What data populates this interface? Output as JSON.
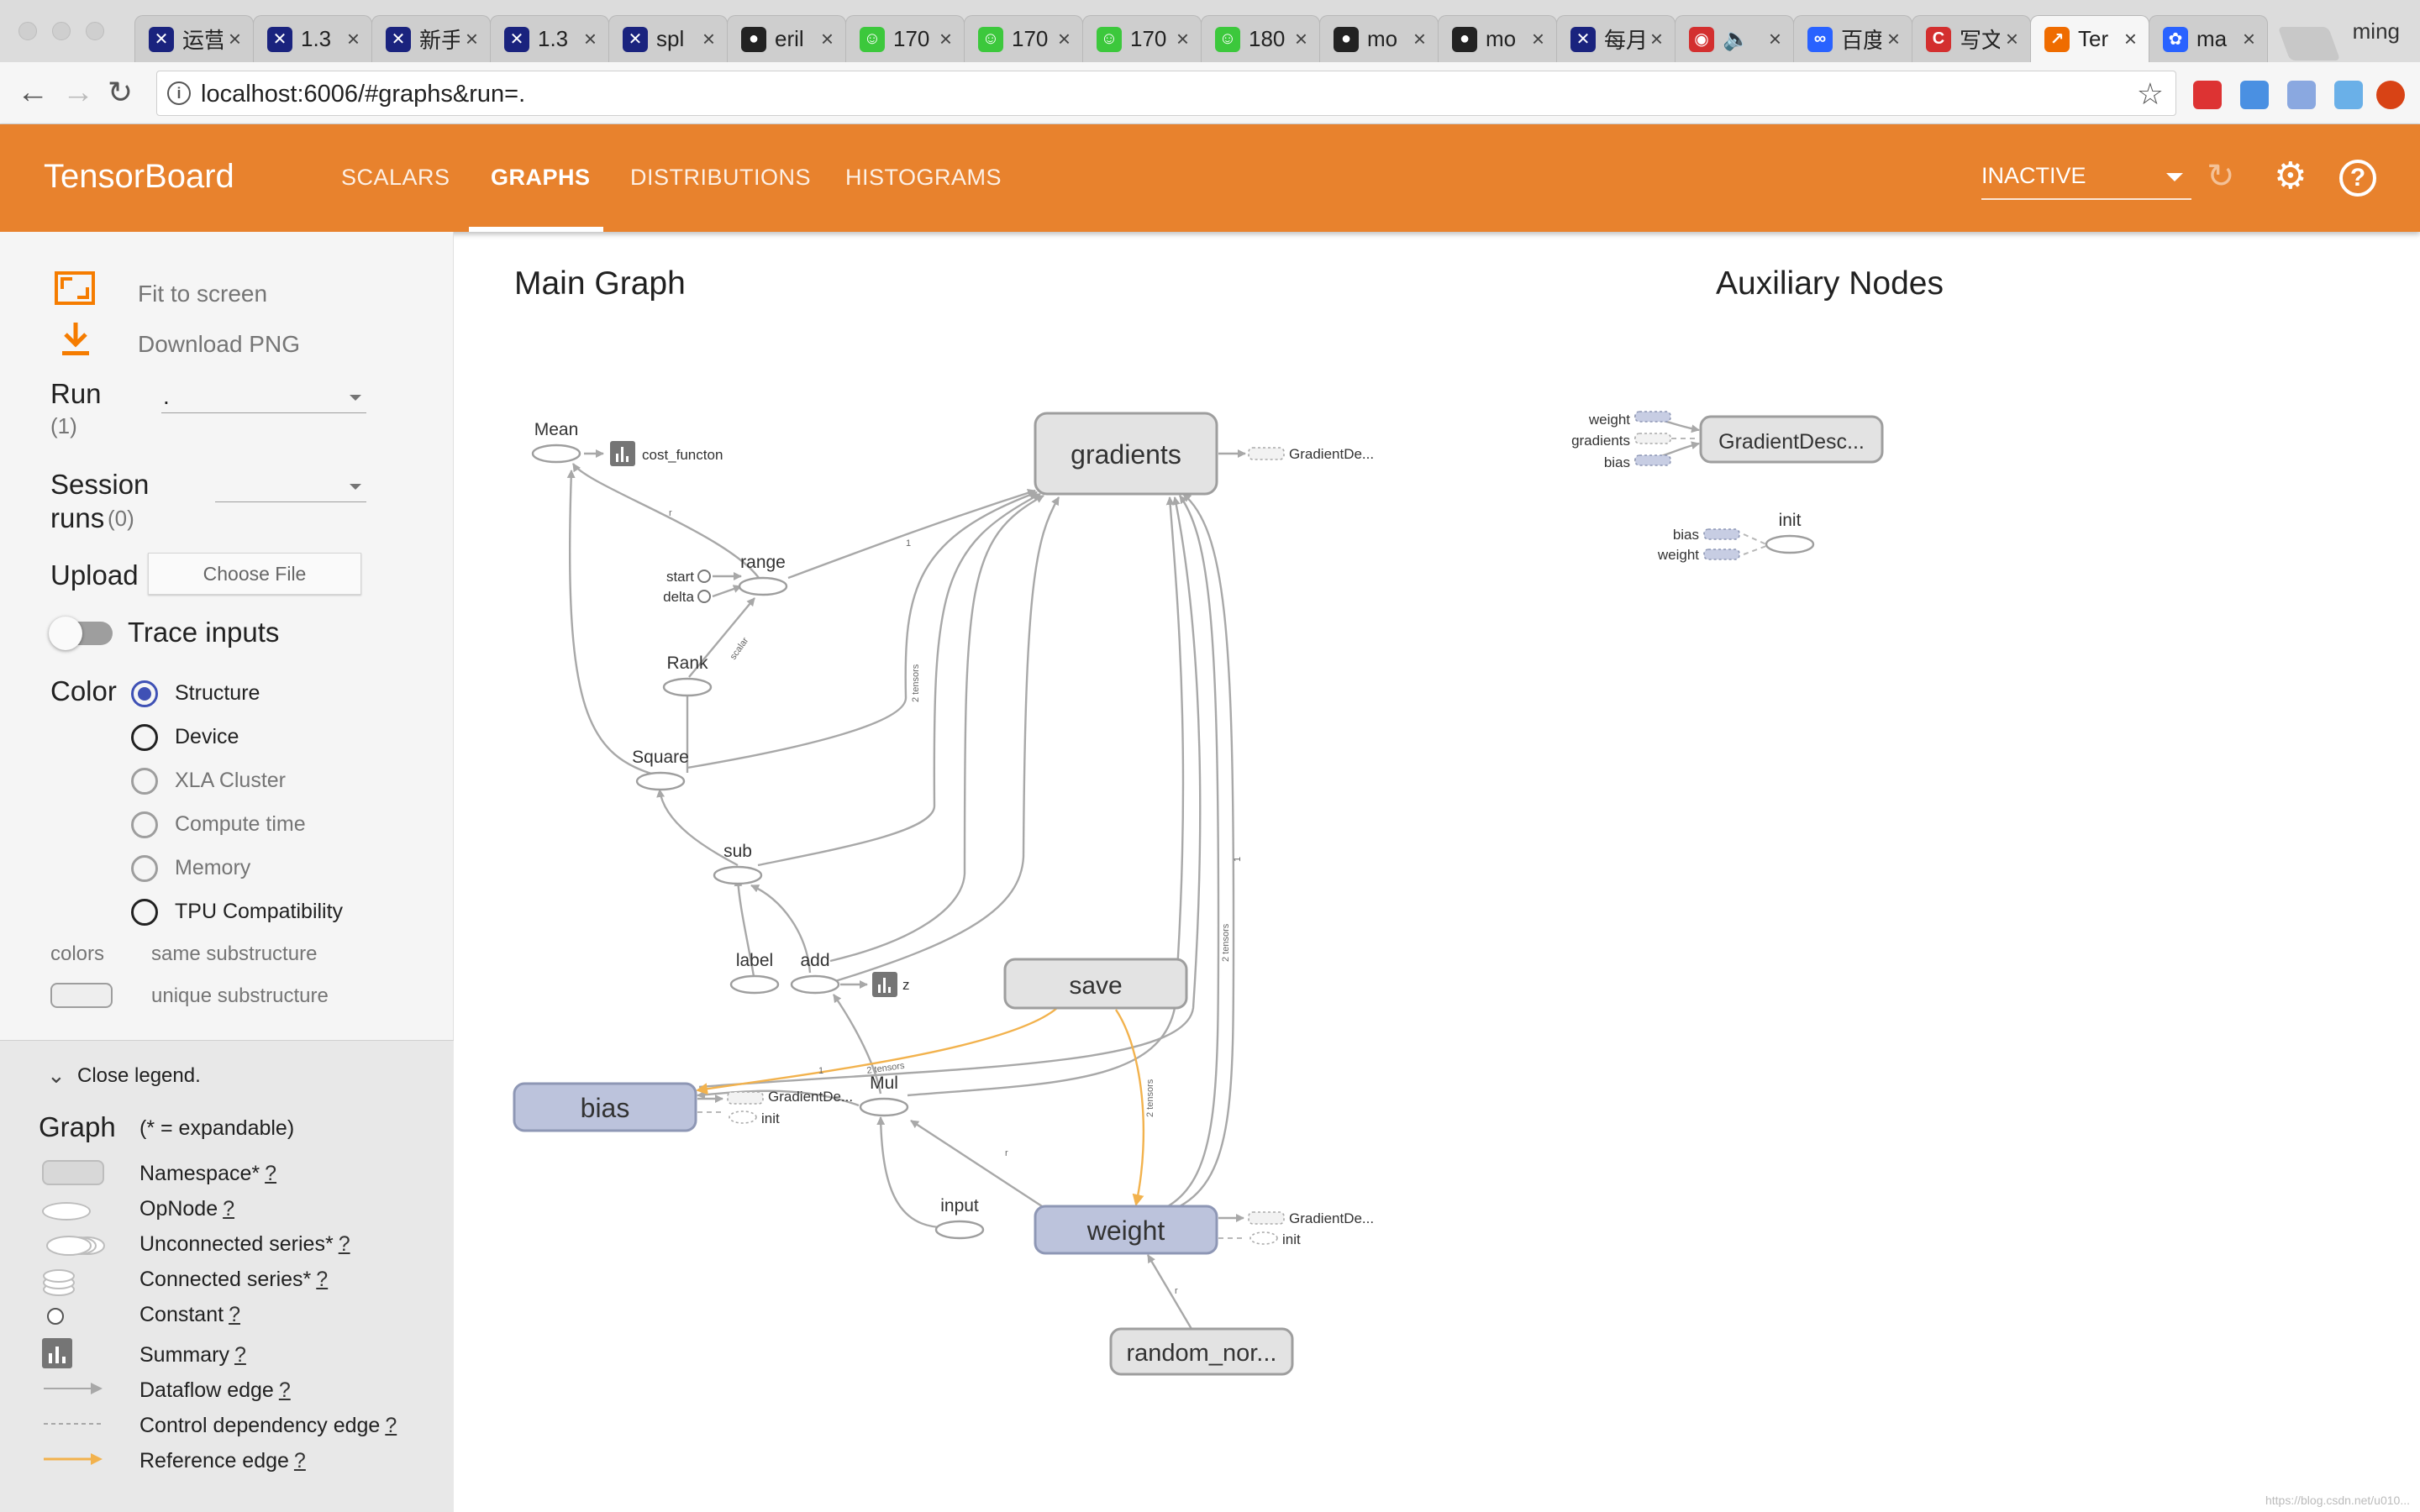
{
  "browser": {
    "tabs": [
      {
        "label": "运营",
        "color": "#1a237e",
        "glyph": "✕"
      },
      {
        "label": "1.3",
        "color": "#1a237e",
        "glyph": "✕"
      },
      {
        "label": "新手",
        "color": "#1a237e",
        "glyph": "✕"
      },
      {
        "label": "1.3",
        "color": "#1a237e",
        "glyph": "✕"
      },
      {
        "label": "spl",
        "color": "#1a237e",
        "glyph": "✕"
      },
      {
        "label": "eril",
        "color": "#222222",
        "glyph": "●"
      },
      {
        "label": "170",
        "color": "#3cc83c",
        "glyph": "☺"
      },
      {
        "label": "170",
        "color": "#3cc83c",
        "glyph": "☺"
      },
      {
        "label": "170",
        "color": "#3cc83c",
        "glyph": "☺"
      },
      {
        "label": "180",
        "color": "#3cc83c",
        "glyph": "☺"
      },
      {
        "label": "mo",
        "color": "#222222",
        "glyph": "●"
      },
      {
        "label": "mo",
        "color": "#222222",
        "glyph": "●"
      },
      {
        "label": "每月",
        "color": "#1a237e",
        "glyph": "✕"
      },
      {
        "label": "🔈",
        "color": "#d32f2f",
        "glyph": "◉"
      },
      {
        "label": "百度",
        "color": "#2962ff",
        "glyph": "∞"
      },
      {
        "label": "写文",
        "color": "#d32f2f",
        "glyph": "C"
      },
      {
        "label": "Ter",
        "color": "#ef6c00",
        "glyph": "↗"
      },
      {
        "label": "ma",
        "color": "#2962ff",
        "glyph": "✿"
      }
    ],
    "profile": "ming",
    "url": "localhost:6006/#graphs&run=."
  },
  "header": {
    "brand": "TensorBoard",
    "nav": [
      "SCALARS",
      "GRAPHS",
      "DISTRIBUTIONS",
      "HISTOGRAMS"
    ],
    "run_status": "INACTIVE"
  },
  "sidebar": {
    "fit": "Fit to screen",
    "download": "Download PNG",
    "run_label": "Run",
    "run_count": "(1)",
    "run_value": ".",
    "session_label_1": "Session",
    "session_label_2": "runs",
    "session_count": "(0)",
    "upload_label": "Upload",
    "choose_file": "Choose File",
    "trace_inputs": "Trace inputs",
    "color_label": "Color",
    "color_options": [
      "Structure",
      "Device",
      "XLA Cluster",
      "Compute time",
      "Memory",
      "TPU Compatibility"
    ],
    "colors_label": "colors",
    "same_sub": "same substructure",
    "unique_sub": "unique substructure"
  },
  "legend": {
    "close": "Close legend.",
    "graph_label": "Graph",
    "expandable": "(* = expandable)",
    "items": [
      "Namespace*",
      "OpNode",
      "Unconnected series*",
      "Connected series*",
      "Constant",
      "Summary",
      "Dataflow edge",
      "Control dependency edge",
      "Reference edge"
    ],
    "q": "?"
  },
  "graph": {
    "main_title": "Main Graph",
    "aux_title": "Auxiliary Nodes",
    "namespaces": {
      "gradients": "gradients",
      "save": "save",
      "bias": "bias",
      "weight": "weight",
      "random": "random_nor...",
      "gd": "GradientDesc..."
    },
    "ops": {
      "mean": "Mean",
      "cost": "cost_functon",
      "range": "range",
      "start": "start",
      "delta": "delta",
      "rank": "Rank",
      "square": "Square",
      "sub": "sub",
      "label": "label",
      "add": "add",
      "z": "z",
      "mul": "Mul",
      "input": "input",
      "init": "init"
    },
    "series": {
      "gd": "GradientDe...",
      "init": "init",
      "weight": "weight",
      "gradients": "gradients",
      "bias": "bias"
    },
    "edge_labels": {
      "two_tensors": "2 tensors",
      "scalar": "scalar",
      "one": "1",
      "r": "r"
    }
  },
  "colors": {
    "header": "#e8822d",
    "namespace": "#e0e0e0",
    "var_ns": "#bcc3dc",
    "edge": "#a8a8a8",
    "ref_edge": "#f2b24d",
    "radio_on": "#3f51b5"
  },
  "watermark": "https://blog.csdn.net/u010..."
}
